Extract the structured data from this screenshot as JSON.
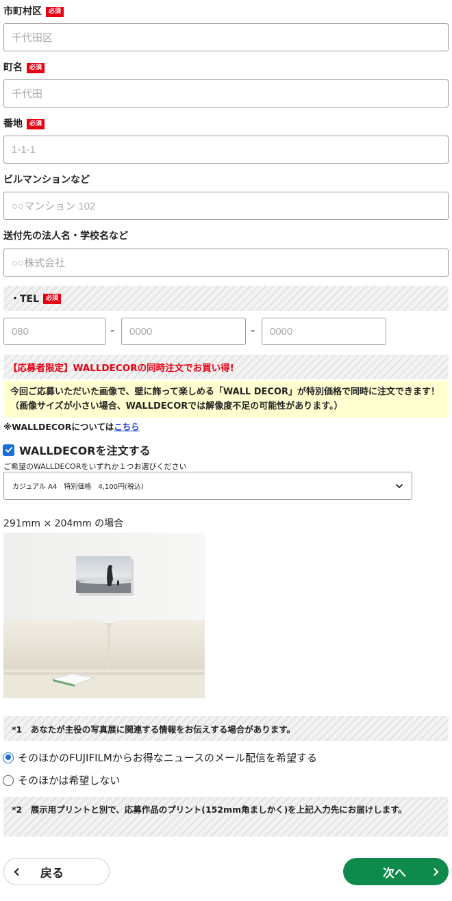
{
  "fields": {
    "city": {
      "label": "市町村区",
      "required": "必須",
      "placeholder": "千代田区"
    },
    "town": {
      "label": "町名",
      "required": "必須",
      "placeholder": "千代田"
    },
    "address": {
      "label": "番地",
      "required": "必須",
      "placeholder": "1-1-1"
    },
    "building": {
      "label": "ビルマンションなど",
      "placeholder": "○○マンション 102"
    },
    "company": {
      "label": "送付先の法人名・学校名など",
      "placeholder": "○○株式会社"
    }
  },
  "tel": {
    "label": "・TEL",
    "required": "必須",
    "placeholders": [
      "080",
      "0000",
      "0000"
    ],
    "separator": "-"
  },
  "promo": {
    "header": "【応募者限定】WALLDECORの同時注文でお買い得!",
    "body": "今回ご応募いただいた画像で、壁に飾って楽しめる「WALL DECOR」が特別価格で同時に注文できます！（画像サイズが小さい場合、WALLDECORでは解像度不足の可能性があります。）",
    "about_prefix": "※WALLDECORについては",
    "about_link": "こちら"
  },
  "walldecor": {
    "checkbox_label": "WALLDECORを注文する",
    "checked": true,
    "select_hint": "ご希望のWALLDECORをいずれか１つお選びください",
    "selected_option": "カジュアル A4　特別価格　4,100円(税込)",
    "size_caption": "291mm × 204mm の場合"
  },
  "note1": "*1　あなたが主役の写真展に関連する情報をお伝えする場合があります。",
  "newsletter": {
    "options": [
      "そのほかのFUJIFILMからお得なニュースのメール配信を希望する",
      "そのほかは希望しない"
    ],
    "selected_index": 0
  },
  "note2": "*2　展示用プリントと別で、応募作品のプリント(152mm角ましかく)を上記入力先にお届けします。",
  "nav": {
    "back": "戻る",
    "next": "次へ"
  },
  "colors": {
    "required": "#e60012",
    "next_button": "#0d8a4c",
    "promo_header": "#e60012",
    "promo_bg": "#ffffd0",
    "link": "#1a3fd6",
    "accent_blue": "#1a6fd6"
  }
}
